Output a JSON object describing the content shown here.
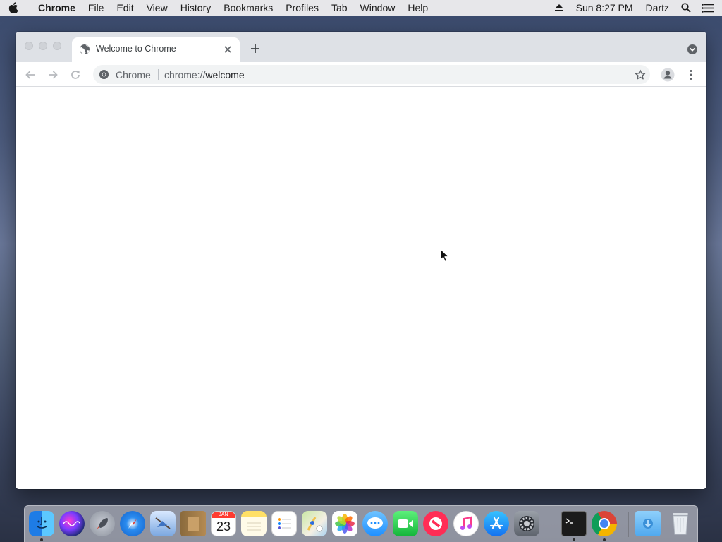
{
  "menubar": {
    "app_name": "Chrome",
    "items": [
      "File",
      "Edit",
      "View",
      "History",
      "Bookmarks",
      "Profiles",
      "Tab",
      "Window",
      "Help"
    ],
    "clock": "Sun 8:27 PM",
    "user": "Dartz",
    "icons": [
      "apple-icon",
      "eject-icon",
      "spotlight-icon",
      "notification-center-icon"
    ]
  },
  "browser": {
    "tab": {
      "title": "Welcome to Chrome",
      "favicon": "globe-icon"
    },
    "omnibox": {
      "site_label": "Chrome",
      "url_scheme": "chrome://",
      "url_host": "welcome"
    }
  },
  "dock": {
    "apps": [
      {
        "name": "Finder",
        "icon": "finder-icon",
        "running": true
      },
      {
        "name": "Siri",
        "icon": "siri-icon",
        "running": false
      },
      {
        "name": "Launchpad",
        "icon": "launchpad-icon",
        "running": false
      },
      {
        "name": "Safari",
        "icon": "safari-icon",
        "running": false
      },
      {
        "name": "Mail",
        "icon": "mail-icon",
        "running": false
      },
      {
        "name": "Contacts",
        "icon": "contacts-icon",
        "running": false
      },
      {
        "name": "Calendar",
        "icon": "calendar-icon",
        "running": false,
        "month": "JAN",
        "day": "23"
      },
      {
        "name": "Notes",
        "icon": "notes-icon",
        "running": false
      },
      {
        "name": "Reminders",
        "icon": "reminders-icon",
        "running": false
      },
      {
        "name": "Maps",
        "icon": "maps-icon",
        "running": false
      },
      {
        "name": "Photos",
        "icon": "photos-icon",
        "running": false
      },
      {
        "name": "Messages",
        "icon": "messages-icon",
        "running": false
      },
      {
        "name": "FaceTime",
        "icon": "facetime-icon",
        "running": false
      },
      {
        "name": "News",
        "icon": "news-icon",
        "running": false
      },
      {
        "name": "iTunes",
        "icon": "itunes-icon",
        "running": false
      },
      {
        "name": "App Store",
        "icon": "app-store-icon",
        "running": false
      },
      {
        "name": "System Preferences",
        "icon": "system-preferences-icon",
        "running": false
      },
      {
        "name": "Terminal",
        "icon": "terminal-icon",
        "running": true
      },
      {
        "name": "Google Chrome",
        "icon": "chrome-icon",
        "running": true
      },
      {
        "name": "Downloads",
        "icon": "downloads-folder-icon",
        "running": false
      },
      {
        "name": "Trash",
        "icon": "trash-icon",
        "running": false
      }
    ]
  },
  "colors": {
    "menubar_bg": "#ececee",
    "tabstrip_bg": "#dee1e6",
    "omnibox_bg": "#f1f3f4",
    "chrome_red": "#db4437",
    "chrome_green": "#0f9d58",
    "chrome_yellow": "#f4b400",
    "chrome_blue": "#4285f4"
  }
}
